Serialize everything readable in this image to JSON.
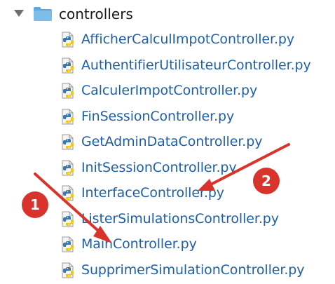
{
  "tree": {
    "folder": {
      "name": "controllers",
      "icon": "folder-icon",
      "expanded": true,
      "color": "#5ba7df"
    },
    "files": [
      {
        "name": "AfficherCalculImpotController.py",
        "icon": "python-file-icon"
      },
      {
        "name": "AuthentifierUtilisateurController.py",
        "icon": "python-file-icon"
      },
      {
        "name": "CalculerImpotController.py",
        "icon": "python-file-icon"
      },
      {
        "name": "FinSessionController.py",
        "icon": "python-file-icon"
      },
      {
        "name": "GetAdminDataController.py",
        "icon": "python-file-icon"
      },
      {
        "name": "InitSessionController.py",
        "icon": "python-file-icon"
      },
      {
        "name": "InterfaceController.py",
        "icon": "python-file-icon"
      },
      {
        "name": "ListerSimulationsController.py",
        "icon": "python-file-icon"
      },
      {
        "name": "MainController.py",
        "icon": "python-file-icon"
      },
      {
        "name": "SupprimerSimulationController.py",
        "icon": "python-file-icon"
      }
    ],
    "file_text_color": "#1f5fa8"
  },
  "annotations": {
    "badges": [
      {
        "label": "1",
        "color": "#d9342b"
      },
      {
        "label": "2",
        "color": "#d9342b"
      }
    ],
    "arrow_color": "#d9342b"
  }
}
